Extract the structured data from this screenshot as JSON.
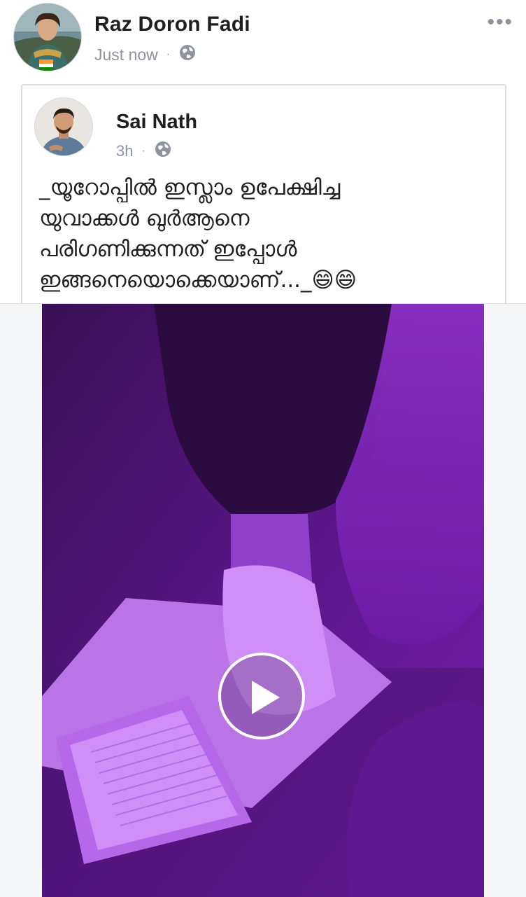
{
  "post": {
    "author": "Raz Doron Fadi",
    "time": "Just now",
    "dot": "·",
    "privacy_icon": "globe-icon",
    "more_icon": "more-options-icon",
    "more_label": "•••"
  },
  "shared_post": {
    "author": "Sai Nath",
    "time": "3h",
    "dot": "·",
    "privacy_icon": "globe-icon",
    "text_lines": [
      "_യൂറോപ്പിൽ ഇസ്ലാം ഉപേക്ഷിച്ച",
      "യുവാക്കൾ ഖുർആനെ",
      "പരിഗണിക്കുന്നത് ഇപ്പോൾ",
      "ഇങ്ങനെയൊക്കെയാണ്..._😄😄"
    ]
  },
  "media": {
    "type": "video",
    "play_icon": "play-icon"
  },
  "colors": {
    "name_text": "#1c1e21",
    "meta_text": "#8d949e",
    "video_tint": "#8a2bd8"
  }
}
